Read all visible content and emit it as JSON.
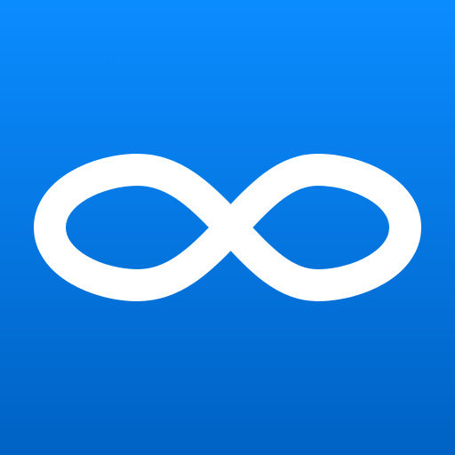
{
  "icon": {
    "symbol": "infinity-icon",
    "gradient_top": "#0a8cff",
    "gradient_bottom": "#0062c4",
    "glyph_color": "#ffffff"
  }
}
